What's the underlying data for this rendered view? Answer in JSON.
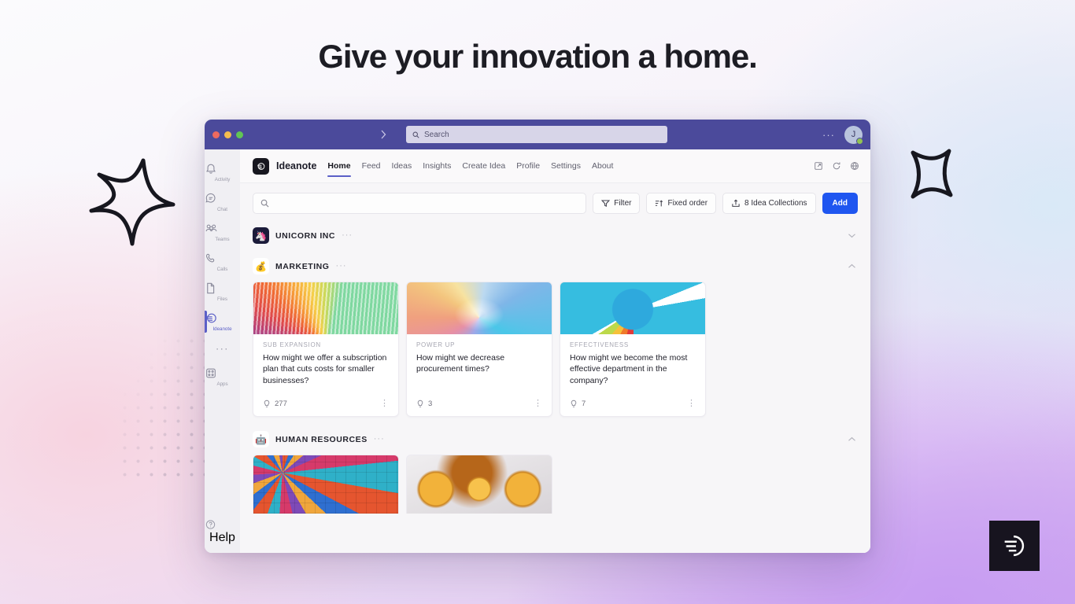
{
  "headline": "Give your innovation a home.",
  "titlebar": {
    "search_placeholder": "Search",
    "back_icon": "chevron-left-icon",
    "forward_icon": "chevron-right-icon",
    "more_label": "···",
    "avatar_initial": "J"
  },
  "rail": {
    "items": [
      {
        "label": "Activity",
        "icon": "bell-icon",
        "active": false
      },
      {
        "label": "Chat",
        "icon": "chat-icon",
        "active": false
      },
      {
        "label": "Teams",
        "icon": "teams-icon",
        "active": false
      },
      {
        "label": "Calls",
        "icon": "phone-icon",
        "active": false
      },
      {
        "label": "Files",
        "icon": "file-icon",
        "active": false
      },
      {
        "label": "Ideanote",
        "icon": "ideanote-icon",
        "active": true
      }
    ],
    "more_label": "···",
    "apps_label": "Apps",
    "help_label": "Help"
  },
  "app": {
    "name": "Ideanote",
    "tabs": [
      {
        "label": "Home",
        "active": true
      },
      {
        "label": "Feed",
        "active": false
      },
      {
        "label": "Ideas",
        "active": false
      },
      {
        "label": "Insights",
        "active": false
      },
      {
        "label": "Create Idea",
        "active": false
      },
      {
        "label": "Profile",
        "active": false
      },
      {
        "label": "Settings",
        "active": false
      },
      {
        "label": "About",
        "active": false
      }
    ],
    "header_icons": [
      "popout-icon",
      "refresh-icon",
      "globe-icon"
    ]
  },
  "toolbar": {
    "search_placeholder": "",
    "filter_label": "Filter",
    "sort_label": "Fixed order",
    "collections_label": "8 Idea Collections",
    "add_label": "Add"
  },
  "sections": [
    {
      "title": "UNICORN INC",
      "icon": "unicorn-icon",
      "emoji": "🦄",
      "dots": "···",
      "chevron": "⌄",
      "expanded": false
    },
    {
      "title": "MARKETING",
      "icon": "moneybag-icon",
      "emoji": "💰",
      "dots": "···",
      "chevron": "⌃",
      "expanded": true
    },
    {
      "title": "HUMAN RESOURCES",
      "icon": "robot-icon",
      "emoji": "🤖",
      "dots": "···",
      "chevron": "⌃",
      "expanded": true
    }
  ],
  "cards": [
    {
      "kicker": "SUB EXPANSION",
      "title": "How might we offer a subscription plan that cuts costs for smaller businesses?",
      "count": "277",
      "thumb": "rainbow-fan-image",
      "kebab": "⋮"
    },
    {
      "kicker": "POWER UP",
      "title": "How might we decrease procurement times?",
      "count": "3",
      "thumb": "winding-path-image",
      "kebab": "⋮"
    },
    {
      "kicker": "EFFECTIVENESS",
      "title": "How might we become the most effective department in the company?",
      "count": "7",
      "thumb": "gauge-image",
      "kebab": "⋮"
    }
  ],
  "hr_cards": [
    {
      "thumb": "people-collage-image"
    },
    {
      "thumb": "gold-coins-image"
    }
  ],
  "colors": {
    "titlebar": "#4b4a9b",
    "accent": "#5b5fc7",
    "add_button": "#1f56f0",
    "logo_badge": "#17141f"
  },
  "logo_badge": {
    "icon": "ideanote-logo-icon"
  }
}
